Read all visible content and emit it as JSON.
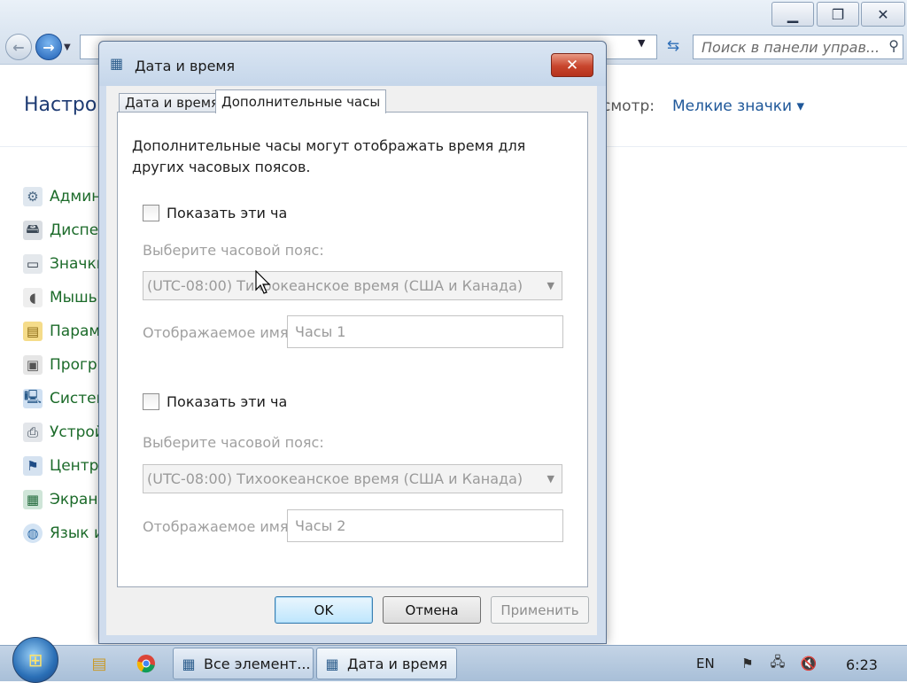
{
  "background": {
    "window_controls": {
      "minimize": "▁",
      "maximize": "❐",
      "close": "✕"
    },
    "search_placeholder": "Поиск в панели управ...",
    "header_title": "Настрой",
    "view_label": "смотр:",
    "view_value": "Мелкие значки ▾",
    "items": [
      {
        "label": "Админ",
        "icon": "admin-tools-icon"
      },
      {
        "label": "Диспет",
        "icon": "device-manager-icon"
      },
      {
        "label": "Значки",
        "icon": "taskbar-icons-icon"
      },
      {
        "label": "Мышь",
        "icon": "mouse-icon"
      },
      {
        "label": "Парам",
        "icon": "folder-options-icon"
      },
      {
        "label": "Прогр",
        "icon": "programs-icon"
      },
      {
        "label": "Систем",
        "icon": "system-icon"
      },
      {
        "label": "Устрой",
        "icon": "devices-icon"
      },
      {
        "label": "Центр",
        "icon": "action-center-icon"
      },
      {
        "label": "Экран",
        "icon": "display-icon"
      },
      {
        "label": "Язык и",
        "icon": "region-language-icon"
      }
    ]
  },
  "dialog": {
    "title": "Дата и время",
    "tabs": [
      {
        "label": "Дата и время",
        "active": false
      },
      {
        "label": "Дополнительные часы",
        "active": true
      }
    ],
    "description": "Дополнительные часы могут отображать время для других часовых поясов.",
    "clocks": [
      {
        "show_label": "Показать эти ча",
        "checked": false,
        "timezone_label": "Выберите часовой пояс:",
        "timezone_value": "(UTC-08:00) Тихоокеанское время (США и Канада)",
        "name_label": "Отображаемое имя",
        "name_value": "Часы 1"
      },
      {
        "show_label": "Показать эти ча",
        "checked": false,
        "timezone_label": "Выберите часовой пояс:",
        "timezone_value": "(UTC-08:00) Тихоокеанское время (США и Канада)",
        "name_label": "Отображаемое имя",
        "name_value": "Часы 2"
      }
    ],
    "buttons": {
      "ok": "OK",
      "cancel": "Отмена",
      "apply": "Применить"
    }
  },
  "taskbar": {
    "tasks": [
      {
        "label": "Все элемент...",
        "icon": "control-panel-icon"
      },
      {
        "label": "Дата и время",
        "icon": "date-time-icon"
      }
    ],
    "language": "EN",
    "clock": "6:23"
  }
}
